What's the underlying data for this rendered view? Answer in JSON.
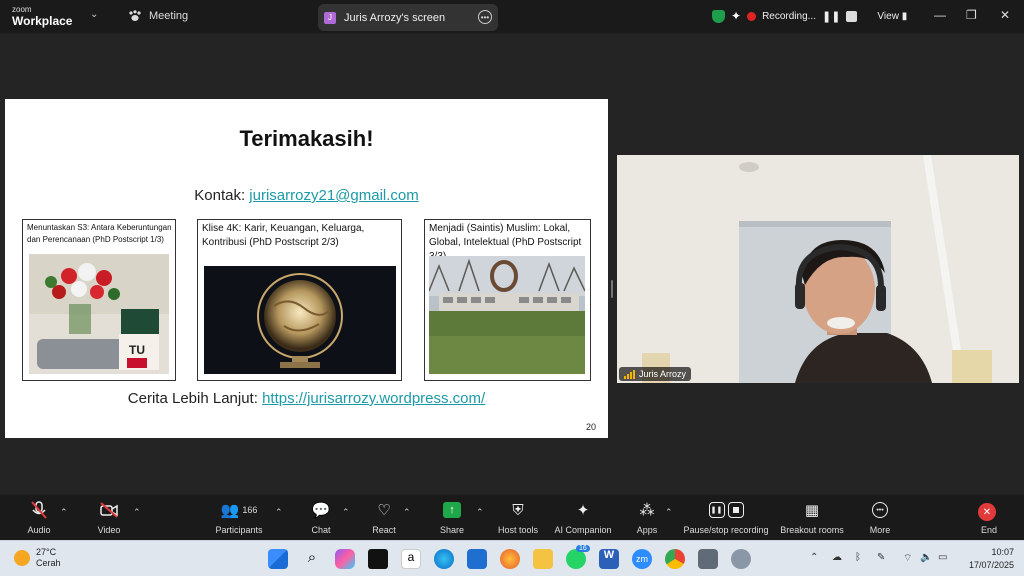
{
  "titlebar": {
    "logo_top": "zoom",
    "logo_bottom": "Workplace",
    "meeting_label": "Meeting",
    "screen_tab_label": "Juris Arrozy's screen",
    "screen_tab_initial": "J",
    "recording_label": "Recording...",
    "view_label": "View"
  },
  "slide": {
    "title": "Terimakasih!",
    "contact_prefix": "Kontak: ",
    "contact_email": "jurisarrozy21@gmail.com",
    "cards": [
      {
        "title": "Menuntaskan S3: Antara Keberuntungan dan Perencanaan (PhD Postscript 1/3)"
      },
      {
        "title": "Klise 4K: Karir, Keuangan, Keluarga, Kontribusi (PhD Postscript 2/3)"
      },
      {
        "title": "Menjadi (Saintis) Muslim: Lokal, Global, Intelektual (PhD Postscript 3/3)"
      }
    ],
    "story_prefix": "Cerita Lebih Lanjut: ",
    "story_link": "https://jurisarrozy.wordpress.com/",
    "page_number": "20"
  },
  "video": {
    "participant_name": "Juris Arrozy"
  },
  "toolbar": {
    "audio": "Audio",
    "video": "Video",
    "participants": "Participants",
    "participants_count": "166",
    "chat": "Chat",
    "react": "React",
    "share": "Share",
    "host_tools": "Host tools",
    "ai_companion": "AI Companion",
    "apps": "Apps",
    "pause_stop": "Pause/stop recording",
    "breakout": "Breakout rooms",
    "more": "More",
    "end": "End"
  },
  "taskbar": {
    "temperature": "27°C",
    "weather": "Cerah",
    "whatsapp_badge": "16",
    "time": "10:07",
    "date": "17/07/2025"
  },
  "colors": {
    "link": "#1c9aa8",
    "end_button": "#e23a3a",
    "share_green": "#1ea84a",
    "recording_red": "#e02424"
  }
}
